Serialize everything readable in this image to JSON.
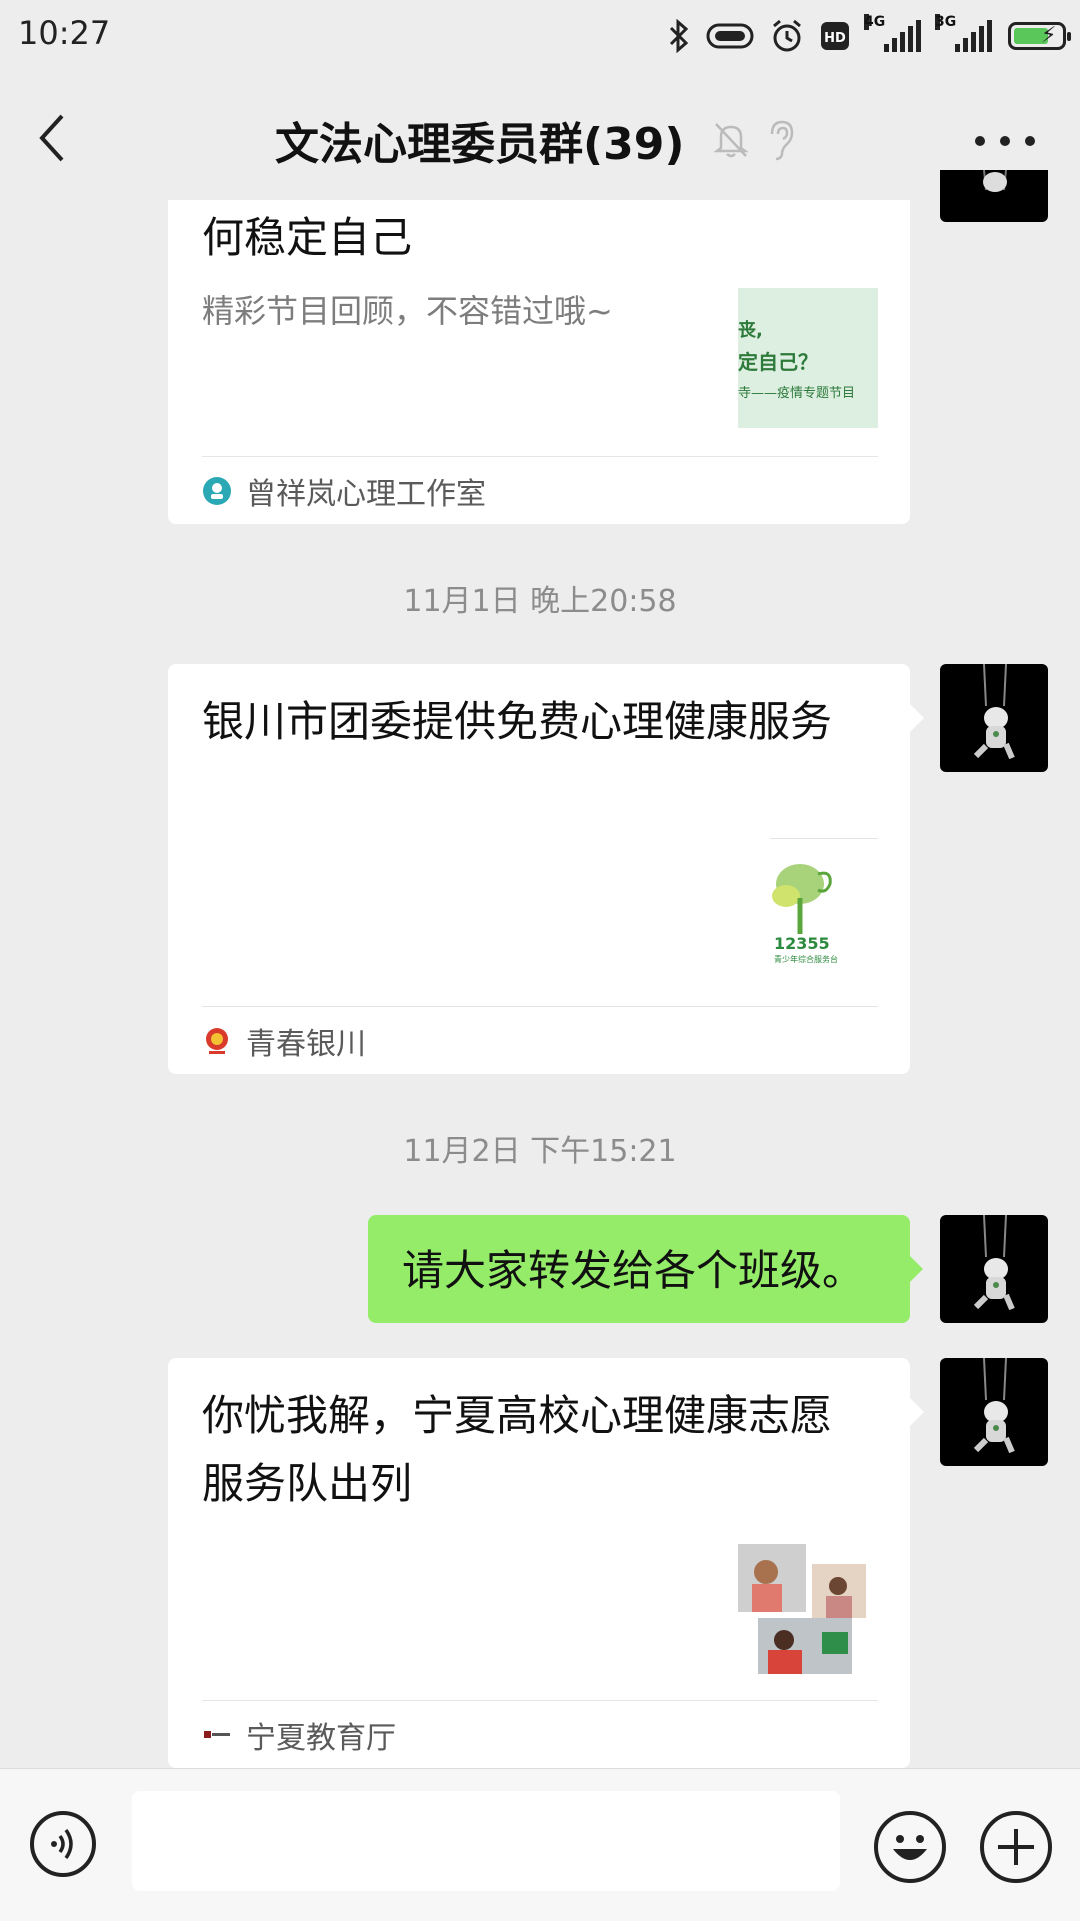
{
  "status_bar": {
    "time": "10:27",
    "network_1": "4G",
    "network_2": "3G",
    "hd": "HD"
  },
  "header": {
    "back_icon": "chevron-left-icon",
    "title": "文法心理委员群(39)",
    "more_icon": "ellipsis-icon"
  },
  "messages": [
    {
      "type": "article",
      "title": "何稳定自己",
      "summary": "精彩节目回顾，不容错过哦~",
      "thumb_lines": [
        "丧,",
        "定自己？",
        "寺——疫情专题节目"
      ],
      "source": "曾祥岚心理工作室"
    },
    {
      "type": "timestamp",
      "text": "11月1日 晚上20:58"
    },
    {
      "type": "article",
      "title": "银川市团委提供免费心理健康服务",
      "thumb_lines": [
        "12355",
        "青少年综合服务台"
      ],
      "source": "青春银川"
    },
    {
      "type": "timestamp",
      "text": "11月2日 下午15:21"
    },
    {
      "type": "text",
      "text": "请大家转发给各个班级。"
    },
    {
      "type": "article",
      "title": "你忧我解，宁夏高校心理健康志愿服务队出列",
      "source": "宁夏教育厅"
    }
  ],
  "colors": {
    "background": "#ededed",
    "bubble_green": "#95ec69",
    "card_white": "#ffffff"
  },
  "footer": {
    "voice_icon": "voice-icon",
    "emoji_icon": "emoji-icon",
    "plus_icon": "plus-icon"
  }
}
